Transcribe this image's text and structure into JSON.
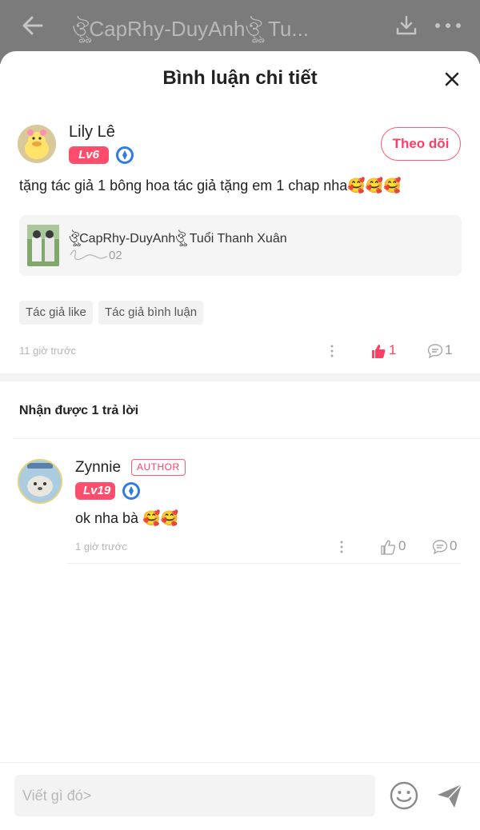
{
  "background_header": {
    "title": "ঔৣCapRhy-DuyAnhঔৣ Tu...",
    "icons": [
      "back-arrow-icon",
      "download-icon",
      "more-icon"
    ]
  },
  "sheet": {
    "title": "Bình luận chi tiết"
  },
  "main_comment": {
    "username": "Lily Lê",
    "level": "Lv6",
    "follow_label": "Theo dõi",
    "text": "tặng tác giả 1 bông hoa tác giả tặng em 1 chap nha",
    "emoji": "🥰🥰🥰",
    "story": {
      "title": "ঔৣCapRhy-DuyAnhঔৣ Tuổi Thanh Xuân",
      "chapter": "02"
    },
    "tags": [
      "Tác giả like",
      "Tác giả bình luận"
    ],
    "time": "11 giờ trước",
    "likes": "1",
    "comments": "1"
  },
  "replies_header": "Nhận được 1 trả lời",
  "reply": {
    "username": "Zynnie",
    "author_badge": "AUTHOR",
    "level": "Lv19",
    "text": "ok nha bà",
    "emoji": "🥰🥰",
    "time": "1 giờ trước",
    "likes": "0",
    "comments": "0"
  },
  "input": {
    "placeholder": "Viết gì đó>"
  },
  "colors": {
    "accent": "#ff3f65",
    "level_badge": "#ff4d6d",
    "verified": "#2f7de1"
  }
}
